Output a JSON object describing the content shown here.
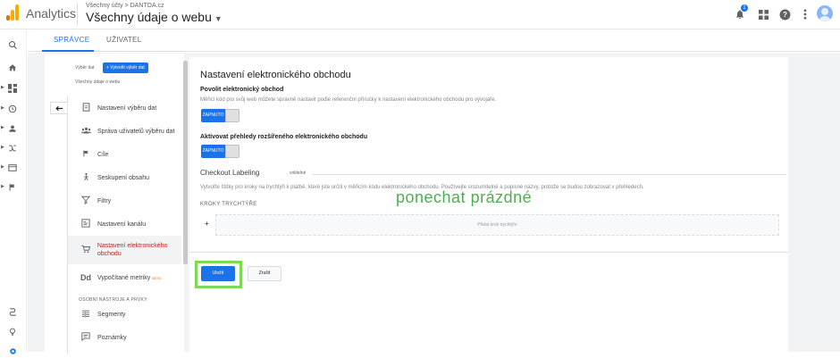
{
  "header": {
    "app_name": "Analytics",
    "breadcrumb": "Všechny účty > DANTOA.cz",
    "property": "Všechny údaje o webu",
    "notification_count": "1",
    "icons": [
      "bell-icon",
      "apps-icon",
      "help-icon",
      "more-icon",
      "avatar"
    ]
  },
  "tabs": [
    {
      "label": "SPRÁVCE",
      "active": true
    },
    {
      "label": "UŽIVATEL",
      "active": false
    }
  ],
  "view_column": {
    "view_label": "Výběr dat",
    "create_button": "+ Vytvořit výběr dat",
    "view_name": "Všechny údaje o webu",
    "items": [
      {
        "label": "Nastavení výběru dat",
        "icon": "document-icon"
      },
      {
        "label": "Správa uživatelů výběru dat",
        "icon": "people-icon"
      },
      {
        "label": "Cíle",
        "icon": "flag-icon"
      },
      {
        "label": "Seskupení obsahu",
        "icon": "person-icon"
      },
      {
        "label": "Filtry",
        "icon": "filter-icon"
      },
      {
        "label": "Nastavení kanálu",
        "icon": "channel-icon"
      },
      {
        "label": "Nastavení elektronického obchodu",
        "icon": "cart-icon",
        "active": true
      },
      {
        "label": "Vypočítané metriky",
        "badge": "BETA",
        "icon": "dd-icon"
      }
    ],
    "section_header": "OSOBNÍ NÁSTROJE A PRVKY",
    "personal_items": [
      {
        "label": "Segmenty",
        "icon": "segments-icon"
      },
      {
        "label": "Poznámky",
        "icon": "notes-icon"
      }
    ]
  },
  "main": {
    "title": "Nastavení elektronického obchodu",
    "enable_label": "Povolit elektronický obchod",
    "enable_desc": "Měřicí kód pro svůj web můžete správně nastavit podle referenční příručky k nastavení elektronického obchodu pro vývojáře.",
    "toggle_on_label": "ZAPNUTO",
    "enhanced_label": "Aktivovat přehledy rozšířeného elektronického obchodu",
    "checkout_title": "Checkout Labeling",
    "checkout_optional": "volitelné",
    "checkout_desc": "Vytvořte štítky pro kroky na trychtýři k platbě, které jste určili v měřicím kódu elektronického obchodu. Používejte srozumitelné a popisné názvy, protože se budou zobrazovat v přehledech.",
    "funnel_header": "KROKY TRYCHTÝŘE",
    "add_step": "Přidat krok trychtýře",
    "plus": "+",
    "annotation": "ponechat prázdné",
    "save": "Uložit",
    "cancel": "Zrušit"
  },
  "colors": {
    "accent": "#1a73e8",
    "active_item": "#c5221f",
    "highlight": "#7ed957",
    "annotation": "#4caf50"
  }
}
